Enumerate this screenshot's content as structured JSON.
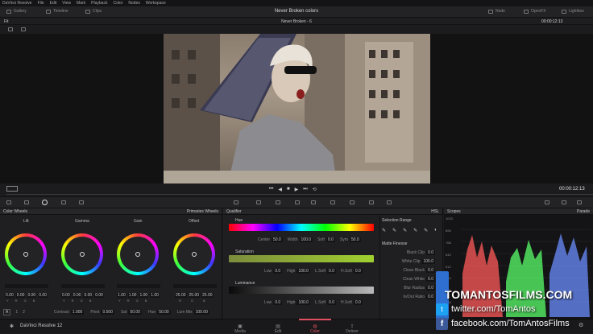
{
  "menu": [
    "DaVinci Resolve",
    "File",
    "Edit",
    "View",
    "Mark",
    "Playback",
    "Color",
    "Nodes",
    "Workspace"
  ],
  "topbar": {
    "gallery": "Gallery",
    "timeline": "Timeline",
    "clips": "Clips",
    "project": "Never Broken colors",
    "node": "Node",
    "openfx": "OpenFX",
    "lightbox": "Lightbox"
  },
  "subbar": {
    "fit": "Fit",
    "clip_name": "Never Broken - 6",
    "timecode": "00:00:12:13"
  },
  "transport": {
    "timecode": "00:00:12:13"
  },
  "color_wheels": {
    "title": "Color Wheels",
    "mode": "Primaries Wheels",
    "wheels": [
      {
        "name": "Lift",
        "values": [
          "0.00",
          "0.00",
          "0.00",
          "0.00"
        ]
      },
      {
        "name": "Gamma",
        "values": [
          "0.00",
          "0.00",
          "0.00",
          "0.00"
        ]
      },
      {
        "name": "Gain",
        "values": [
          "1.00",
          "1.00",
          "1.00",
          "1.00"
        ]
      },
      {
        "name": "Offset",
        "values": [
          "25.00",
          "25.00",
          "25.00"
        ]
      }
    ],
    "letters": [
      "Y",
      "R",
      "G",
      "B"
    ],
    "offset_letters": [
      "R",
      "G",
      "B"
    ],
    "footer": {
      "a_label": "A",
      "page1": "1",
      "page2": "2",
      "contrast_label": "Contrast",
      "contrast": "1.000",
      "pivot_label": "Pivot",
      "pivot": "0.500",
      "sat_label": "Sat",
      "sat": "50.00",
      "hue_label": "Hue",
      "hue": "50.00",
      "lummix_label": "Lum Mix",
      "lummix": "100.00"
    }
  },
  "qualifier": {
    "title": "Qualifier",
    "mode": "HSL",
    "hue": {
      "label": "Hue",
      "center_label": "Center",
      "center": "50.0",
      "width_label": "Width",
      "width": "100.0",
      "soft_label": "Soft",
      "soft": "0.0",
      "sym_label": "Sym",
      "sym": "50.0"
    },
    "saturation": {
      "label": "Saturation",
      "low_label": "Low",
      "low": "0.0",
      "high_label": "High",
      "high": "100.0",
      "lsoft_label": "L.Soft",
      "lsoft": "0.0",
      "hsoft_label": "H.Soft",
      "hsoft": "0.0"
    },
    "luminance": {
      "label": "Luminance",
      "low_label": "Low",
      "low": "0.0",
      "high_label": "High",
      "high": "100.0",
      "lsoft_label": "L.Soft",
      "lsoft": "0.0",
      "hsoft_label": "H.Soft",
      "hsoft": "0.0"
    },
    "selection_range": "Selection Range",
    "matte_finesse": "Matte Finesse",
    "finesse": [
      {
        "label": "Black Clip",
        "value": "0.0"
      },
      {
        "label": "White Clip",
        "value": "100.0"
      },
      {
        "label": "Clean Black",
        "value": "0.0"
      },
      {
        "label": "Clean White",
        "value": "0.0"
      },
      {
        "label": "Blur Radius",
        "value": "0.0"
      },
      {
        "label": "In/Out Ratio",
        "value": "0.0"
      }
    ]
  },
  "scopes": {
    "title": "Scopes",
    "mode": "Parade",
    "ticks": [
      "1023",
      "896",
      "768",
      "640",
      "512",
      "384",
      "256",
      "128",
      "0"
    ]
  },
  "bottom": {
    "app": "DaVinci Resolve 12",
    "pages": [
      "Media",
      "Edit",
      "Color",
      "Deliver"
    ],
    "active": "Color"
  },
  "watermark": {
    "brand": "TOMANTOSFILMS.COM",
    "twitter": "twitter.com/TomAntos",
    "facebook": "facebook.com/TomAntosFilms"
  }
}
